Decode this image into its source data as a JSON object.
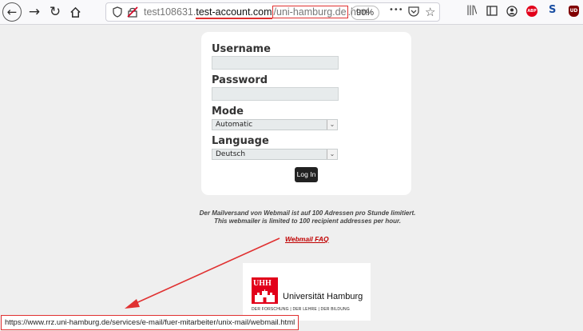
{
  "browser": {
    "url_prefix": "test108631.",
    "url_host": "test-account.com",
    "url_path_highlight": "/uni-hamburg.de",
    "url_suffix": ".html",
    "zoom": "90%",
    "menu_dots": "•••",
    "ext_abp": "ABP",
    "ext_s": "S",
    "ext_ud": "UD"
  },
  "login": {
    "username_label": "Username",
    "username_value": "",
    "password_label": "Password",
    "password_value": "",
    "mode_label": "Mode",
    "mode_selected": "Automatic",
    "language_label": "Language",
    "language_selected": "Deutsch",
    "login_button": "Log In"
  },
  "notice": {
    "line_de": "Der Mailversand von Webmail ist auf 100 Adressen pro Stunde limitiert.",
    "line_en": "This webmailer is limited to 100 recipient addresses per hour.",
    "faq_link": "Webmail FAQ"
  },
  "logo": {
    "mark": "UHH",
    "name": "Universität Hamburg",
    "tagline": "DER FORSCHUNG | DER LEHRE | DER BILDUNG"
  },
  "status_url": "https://www.rrz.uni-hamburg.de/services/e-mail/fuer-mitarbeiter/unix-mail/webmail.html",
  "colors": {
    "annotation": "#e03131",
    "brand_red": "#e2001a",
    "link_red": "#c00000"
  }
}
